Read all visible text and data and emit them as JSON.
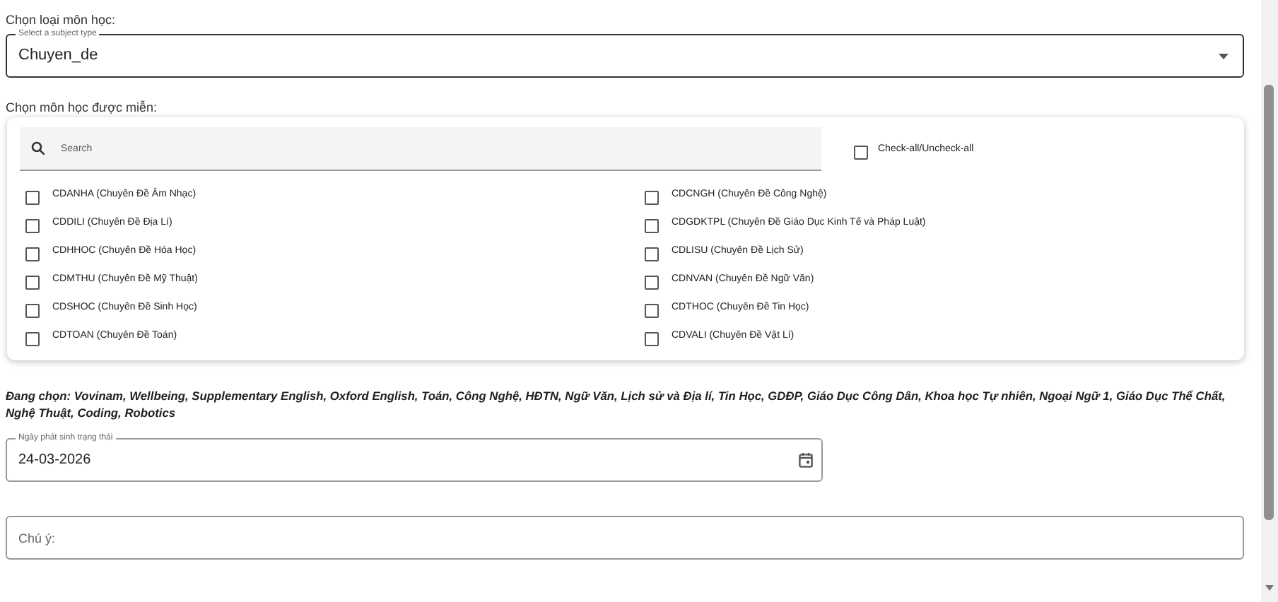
{
  "subject_type": {
    "label": "Chọn loại môn học:",
    "legend": "Select a subject type",
    "value": "Chuyen_de"
  },
  "exempt": {
    "label": "Chọn môn học được miễn:",
    "search": {
      "placeholder": "Search"
    },
    "check_all": {
      "label": "Check-all/Uncheck-all",
      "checked": false
    },
    "items": [
      {
        "label": "CDANHA (Chuyên Đề Âm Nhạc)",
        "checked": false
      },
      {
        "label": "CDCNGH (Chuyên Đề Công Nghệ)",
        "checked": false
      },
      {
        "label": "CDDILI (Chuyên Đề Địa Lí)",
        "checked": false
      },
      {
        "label": "CDGDKTPL (Chuyên Đề Giáo Dục Kinh Tế và Pháp Luật)",
        "checked": false
      },
      {
        "label": "CDHHOC (Chuyên Đề Hóa Học)",
        "checked": false
      },
      {
        "label": "CDLISU (Chuyên Đề Lịch Sử)",
        "checked": false
      },
      {
        "label": "CDMTHU (Chuyên Đề Mỹ Thuật)",
        "checked": false
      },
      {
        "label": "CDNVAN (Chuyên Đề Ngữ Văn)",
        "checked": false
      },
      {
        "label": "CDSHOC (Chuyên Đề Sinh Học)",
        "checked": false
      },
      {
        "label": "CDTHOC (Chuyên Đề Tin Học)",
        "checked": false
      },
      {
        "label": "CDTOAN (Chuyên Đề Toán)",
        "checked": false
      },
      {
        "label": "CDVALI (Chuyên Đề Vật Lí)",
        "checked": false
      }
    ]
  },
  "selected_summary": "Đang chọn: Vovinam, Wellbeing, Supplementary English, Oxford English, Toán, Công Nghệ, HĐTN, Ngữ Văn, Lịch sử và Địa lí, Tin Học, GDĐP, Giáo Dục Công Dân, Khoa học Tự nhiên, Ngoại Ngữ 1, Giáo Dục Thể Chất, Nghệ Thuật, Coding, Robotics",
  "date_field": {
    "legend": "Ngày phát sinh trạng thái",
    "value": "24-03-2026"
  },
  "note_field": {
    "placeholder": "Chú ý:"
  }
}
